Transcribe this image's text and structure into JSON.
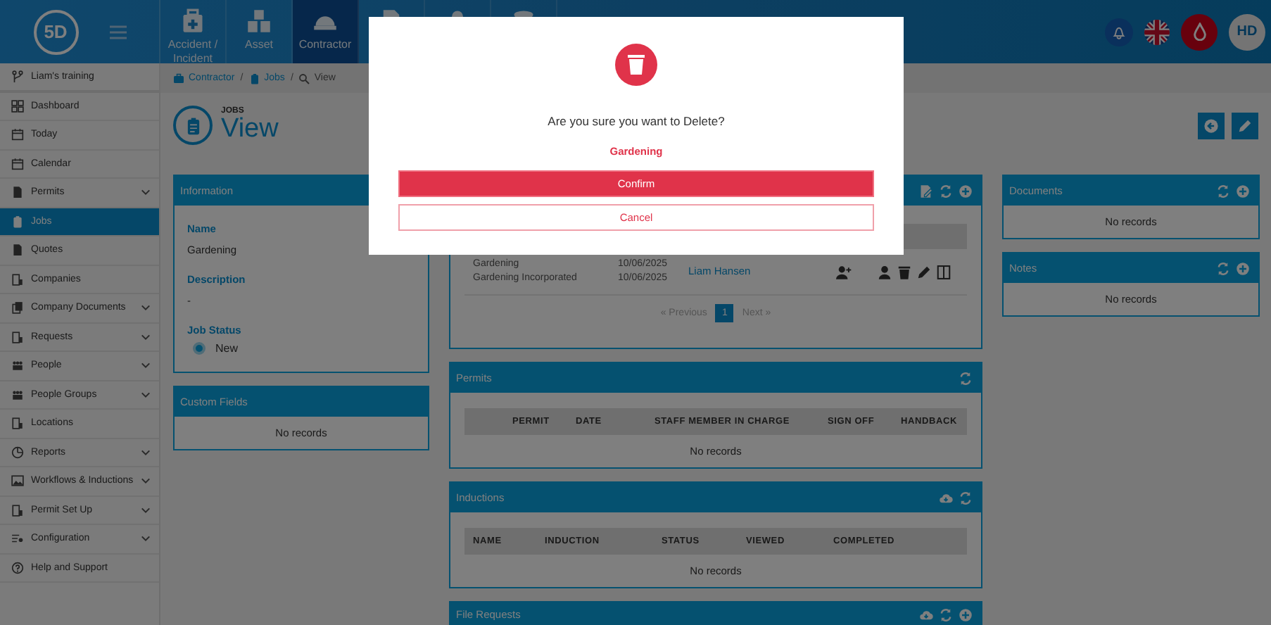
{
  "header": {
    "logo": "5D",
    "tiles": [
      {
        "label": "Accident / Incident",
        "selected": false
      },
      {
        "label": "Asset",
        "selected": false
      },
      {
        "label": "Contractor",
        "selected": true
      },
      {
        "selected": false
      },
      {
        "selected": false
      },
      {
        "selected": false
      }
    ],
    "avatar": "HD"
  },
  "sidebar": {
    "items": [
      {
        "label": "Liam's training",
        "expandable": false,
        "selected": false
      },
      {
        "label": "Dashboard",
        "expandable": false,
        "selected": false
      },
      {
        "label": "Today",
        "expandable": false,
        "selected": false
      },
      {
        "label": "Calendar",
        "expandable": false,
        "selected": false
      },
      {
        "label": "Permits",
        "expandable": true,
        "selected": false
      },
      {
        "label": "Jobs",
        "expandable": false,
        "selected": true
      },
      {
        "label": "Quotes",
        "expandable": false,
        "selected": false
      },
      {
        "label": "Companies",
        "expandable": false,
        "selected": false
      },
      {
        "label": "Company Documents",
        "expandable": true,
        "selected": false
      },
      {
        "label": "Requests",
        "expandable": true,
        "selected": false
      },
      {
        "label": "People",
        "expandable": true,
        "selected": false
      },
      {
        "label": "People Groups",
        "expandable": true,
        "selected": false
      },
      {
        "label": "Locations",
        "expandable": false,
        "selected": false
      },
      {
        "label": "Reports",
        "expandable": true,
        "selected": false
      },
      {
        "label": "Workflows & Inductions",
        "expandable": true,
        "selected": false
      },
      {
        "label": "Permit Set Up",
        "expandable": true,
        "selected": false
      },
      {
        "label": "Configuration",
        "expandable": true,
        "selected": false
      },
      {
        "label": "Help and Support",
        "expandable": false,
        "selected": false
      }
    ]
  },
  "breadcrumb": {
    "separator": "/",
    "items": [
      {
        "label": "Contractor"
      },
      {
        "label": "Jobs"
      },
      {
        "label": "View"
      }
    ]
  },
  "page": {
    "eyebrow": "JOBS",
    "title": "View"
  },
  "information": {
    "title": "Information",
    "fields": [
      {
        "label": "Name",
        "value": "Gardening",
        "kind": "text"
      },
      {
        "label": "Description",
        "value": "-",
        "kind": "text"
      },
      {
        "label": "Job Status",
        "value": "New",
        "kind": "status"
      }
    ]
  },
  "custom_fields": {
    "title": "Custom Fields",
    "empty": "No records"
  },
  "jobs_panel": {
    "rows": [
      {
        "column_1": [
          "Gardening",
          "Gardening Incorporated"
        ],
        "column_2": [
          "10/06/2025",
          "10/06/2025"
        ],
        "column_3": "Liam Hansen"
      }
    ],
    "pagination": {
      "previous": {
        "label": "« Previous",
        "disabled": true
      },
      "pages": [
        {
          "label": "1",
          "selected": true
        }
      ],
      "next": {
        "label": "Next »",
        "disabled": true
      }
    }
  },
  "permits": {
    "title": "Permits",
    "columns": [
      "PERMIT",
      "DATE",
      "STAFF MEMBER IN CHARGE",
      "SIGN OFF",
      "HANDBACK"
    ],
    "empty": "No records"
  },
  "inductions": {
    "title": "Inductions",
    "columns": [
      "NAME",
      "INDUCTION",
      "STATUS",
      "VIEWED",
      "COMPLETED"
    ],
    "empty": "No records"
  },
  "file_requests": {
    "title": "File Requests"
  },
  "documents": {
    "title": "Documents",
    "empty": "No records"
  },
  "notes": {
    "title": "Notes",
    "empty": "No records"
  },
  "dialog": {
    "message": "Are you sure you want to Delete?",
    "item": "Gardening",
    "confirm": "Confirm",
    "cancel": "Cancel"
  }
}
